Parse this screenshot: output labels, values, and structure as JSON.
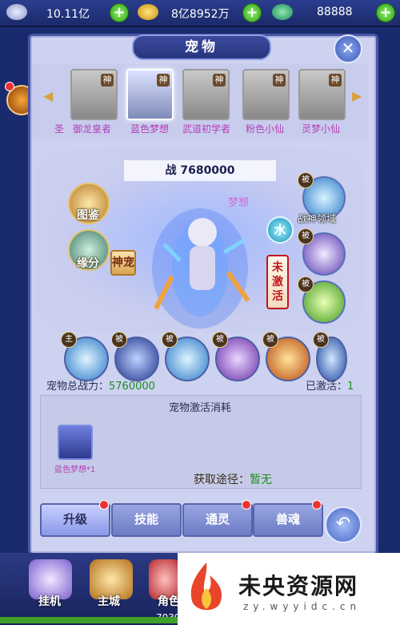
{
  "currency": [
    {
      "icon": "silver-ingot-icon",
      "value": "10.11亿"
    },
    {
      "icon": "gold-ingot-icon",
      "value": "8亿8952万"
    },
    {
      "icon": "jade-icon",
      "value": "88888"
    }
  ],
  "panel": {
    "title": "宠物",
    "close_icon": "close-icon"
  },
  "pets": [
    {
      "name": "御龙皇者",
      "badge": "神"
    },
    {
      "name": "蓝色梦想",
      "badge": "神"
    },
    {
      "name": "武道初学者",
      "badge": "神"
    },
    {
      "name": "粉色小仙",
      "badge": "神"
    },
    {
      "name": "灵梦小仙",
      "badge": "神"
    }
  ],
  "left_partial": "圣",
  "power_label": "战 7680000",
  "stage_name": "梦想",
  "left_buttons": [
    {
      "label": "图鉴"
    },
    {
      "label": "缘分"
    }
  ],
  "divine_tag": "神宠",
  "element_tag": "水",
  "status_tag": "未激活",
  "right_skills": [
    {
      "badge": "被",
      "label": "战神领域"
    },
    {
      "badge": "被",
      "label": ""
    },
    {
      "badge": "被",
      "label": ""
    }
  ],
  "skill_row": [
    {
      "badge": "主"
    },
    {
      "badge": "被"
    },
    {
      "badge": "被"
    },
    {
      "badge": "被"
    },
    {
      "badge": "被"
    },
    {
      "badge": "被"
    }
  ],
  "total_power": {
    "label": "宠物总战力：",
    "value": "5760000"
  },
  "activated": {
    "label": "已激活：",
    "value": "1"
  },
  "cost": {
    "title": "宠物激活消耗",
    "item_name": "蓝色梦想*1"
  },
  "source": {
    "label": "获取途径：",
    "value": "暂无"
  },
  "tabs": [
    {
      "label": "升级"
    },
    {
      "label": "技能"
    },
    {
      "label": "通灵"
    },
    {
      "label": "兽魂"
    }
  ],
  "back_icon": "back-arrow-icon",
  "bottom_nav": [
    {
      "label": "挂机"
    },
    {
      "label": "主城"
    },
    {
      "label": "角色",
      "sub": "7039"
    }
  ],
  "watermark": {
    "title": "未央资源网",
    "subtitle": "zy.wyyidc.cn"
  },
  "colors": {
    "panel": "#cdd2f0",
    "accent": "#3c4a9e",
    "pet_name": "#b43fb6",
    "green": "#1f8a1f"
  }
}
